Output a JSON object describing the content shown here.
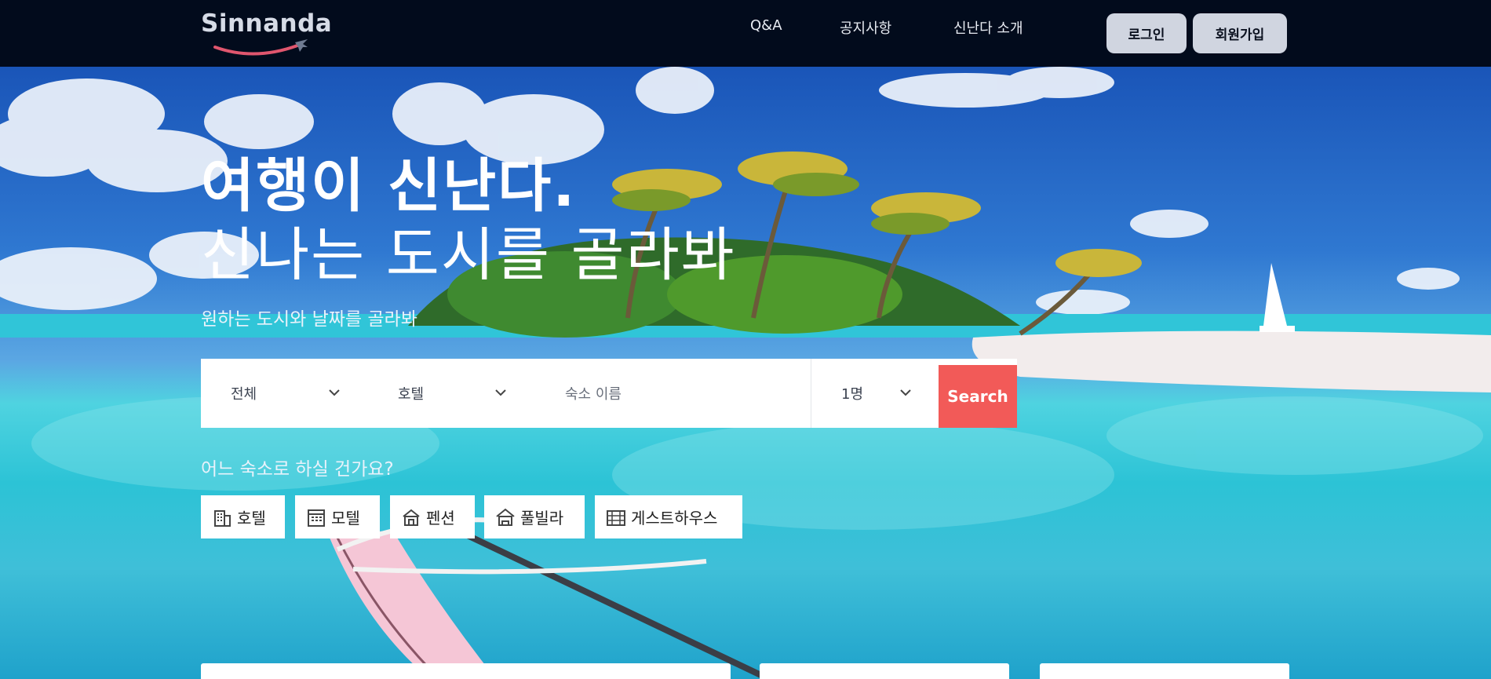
{
  "nav": {
    "logo": "Sinnanda",
    "links": [
      "Q&A",
      "공지사항",
      "신난다 소개"
    ],
    "login": "로그인",
    "signup": "회원가입"
  },
  "hero": {
    "title_bold": "여행이 신난다.",
    "title_light": "신나는 도시를 골라봐",
    "subtitle": "원하는 도시와 날짜를 골라봐"
  },
  "search": {
    "region": "전체",
    "type": "호텔",
    "name_placeholder": "숙소 이름",
    "guests": "1명",
    "button": "Search"
  },
  "categories": {
    "question": "어느 숙소로 하실 건가요?",
    "items": [
      {
        "label": "호텔",
        "icon": "hotel-icon"
      },
      {
        "label": "모텔",
        "icon": "motel-icon"
      },
      {
        "label": "펜션",
        "icon": "pension-icon"
      },
      {
        "label": "풀빌라",
        "icon": "pool-villa-icon"
      },
      {
        "label": "게스트하우스",
        "icon": "guesthouse-icon"
      }
    ]
  },
  "colors": {
    "nav_bg": "#020b1c",
    "accent": "#f25a58",
    "nav_button_bg": "#d0d5e0"
  }
}
